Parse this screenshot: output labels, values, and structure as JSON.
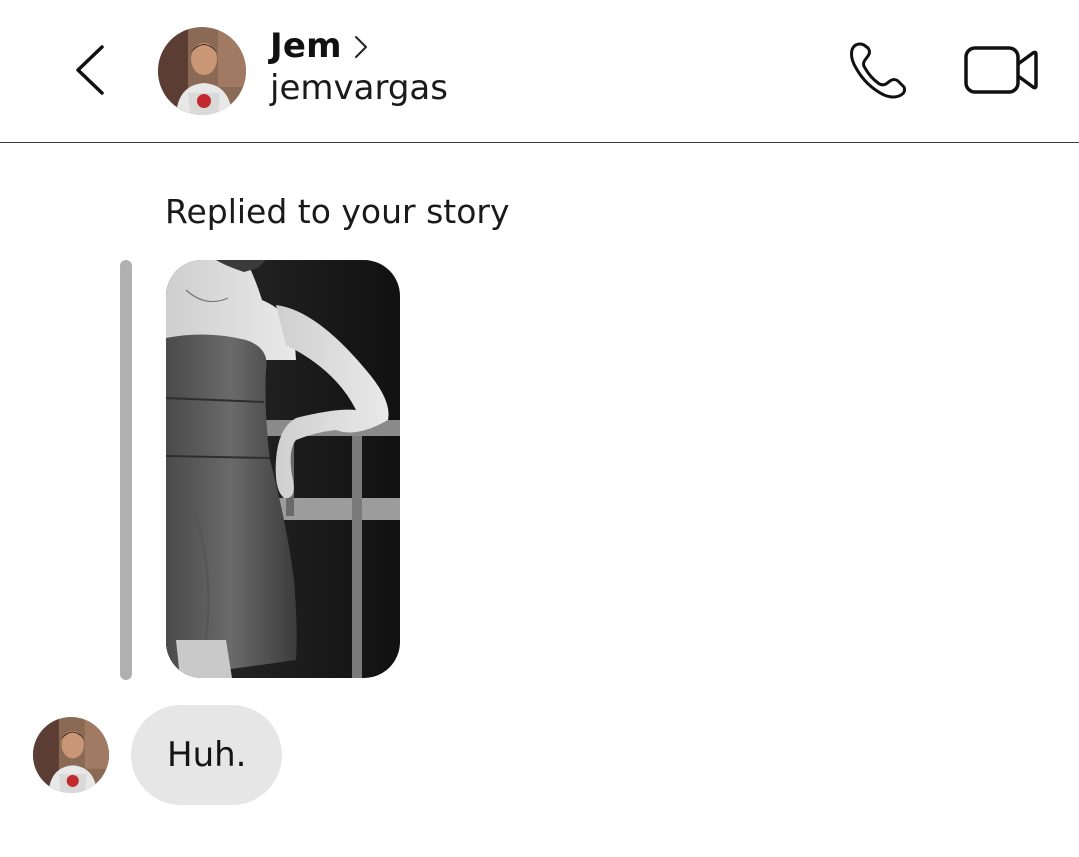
{
  "header": {
    "back_icon": "chevron-left-icon",
    "contact_name": "Jem",
    "contact_username": "jemvargas",
    "profile_chevron_icon": "chevron-right-icon",
    "call_icon": "phone-icon",
    "video_icon": "video-camera-icon"
  },
  "story_reply": {
    "label": "Replied to your story"
  },
  "messages": [
    {
      "text": "Huh."
    }
  ],
  "colors": {
    "bubble_background": "#e6e6e6",
    "reply_bar": "#b0b0b0",
    "divider": "#3a3a3a"
  }
}
